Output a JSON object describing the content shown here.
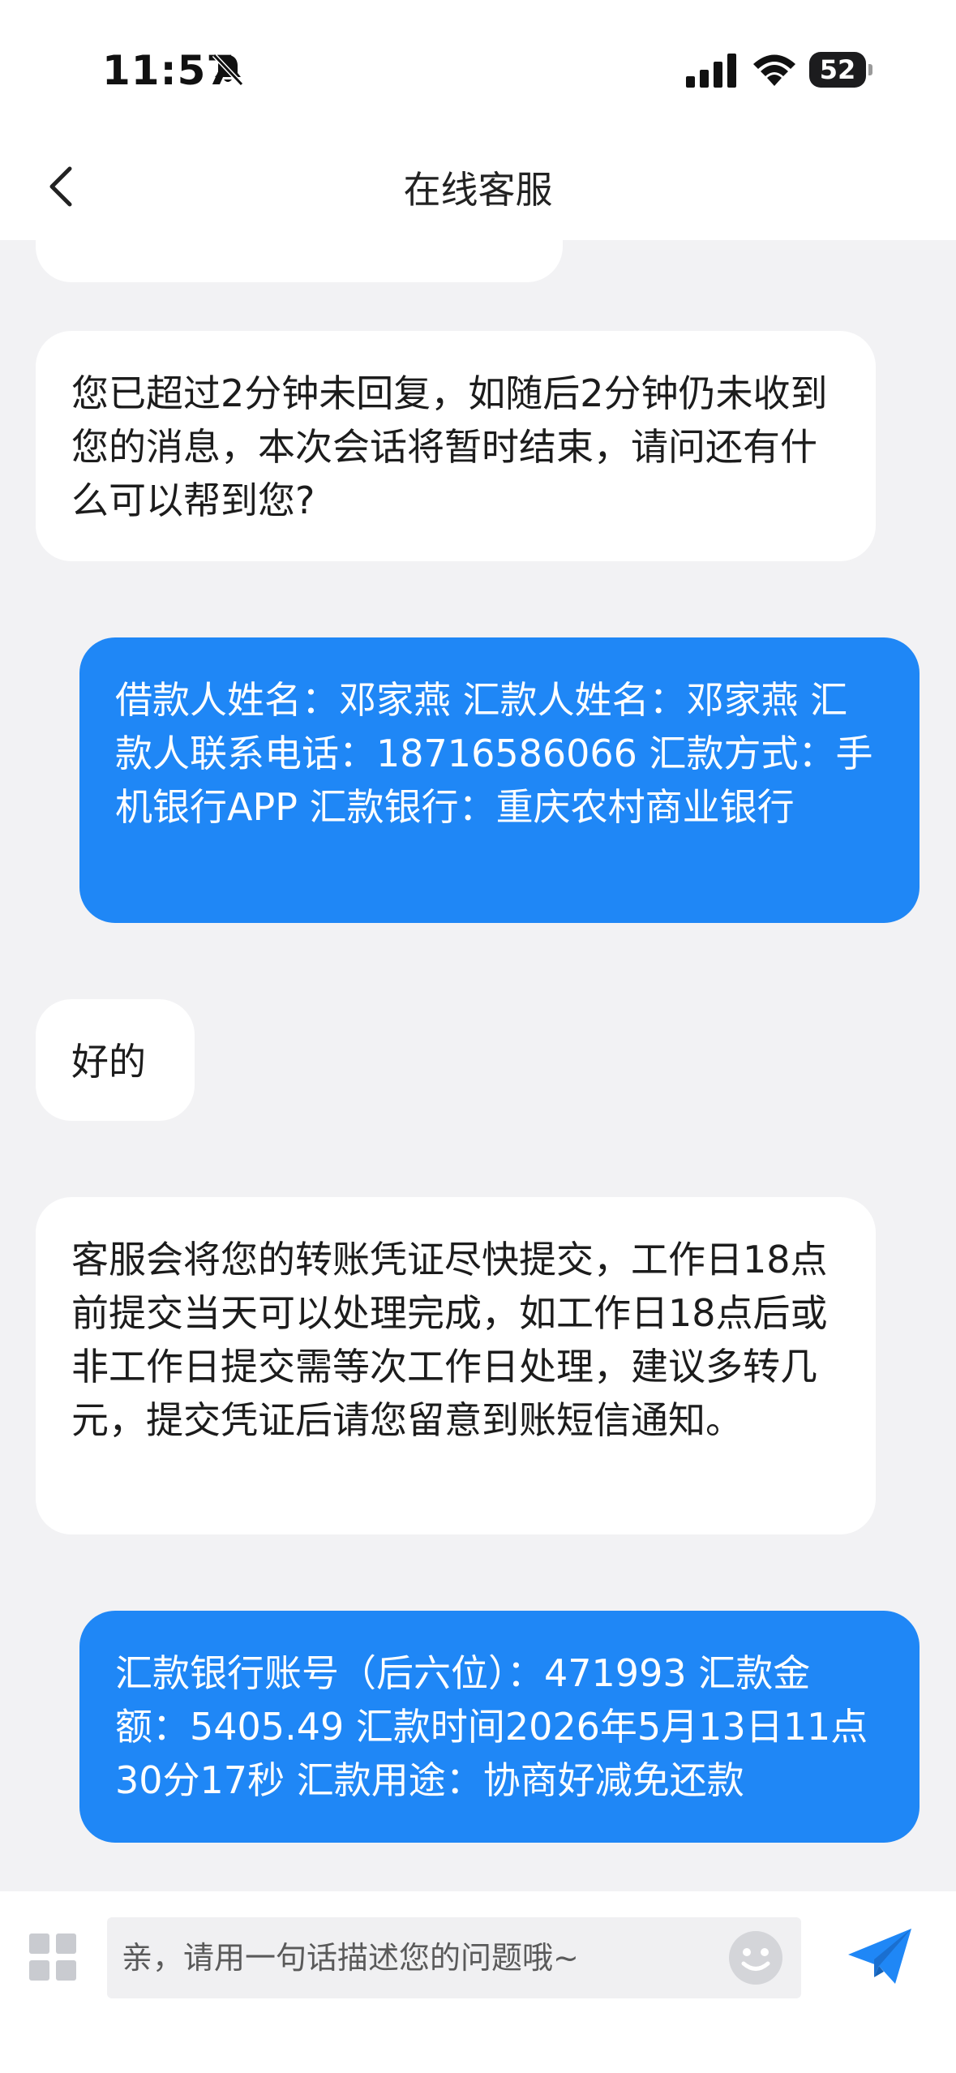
{
  "status_bar": {
    "time": "11:57",
    "battery": "52"
  },
  "header": {
    "title": "在线客服"
  },
  "messages": [
    {
      "side": "left",
      "text": "您已超过2分钟未回复，如随后2分钟仍未收到您的消息，本次会话将暂时结束，请问还有什么可以帮到您?"
    },
    {
      "side": "right",
      "text": "借款人姓名：邓家燕 汇款人姓名：邓家燕 汇款人联系电话：18716586066 汇款方式：手机银行APP 汇款银行：重庆农村商业银行"
    },
    {
      "side": "left",
      "text": "好的"
    },
    {
      "side": "left",
      "text": "客服会将您的转账凭证尽快提交，工作日18点前提交当天可以处理完成，如工作日18点后或非工作日提交需等次工作日处理，建议多转几元，提交凭证后请您留意到账短信通知。"
    },
    {
      "side": "right",
      "text": "汇款银行账号（后六位）：471993 汇款金额：5405.49 汇款时间2026年5月13日11点30分17秒 汇款用途：协商好减免还款"
    }
  ],
  "composer": {
    "placeholder": "亲，请用一句话描述您的问题哦~"
  },
  "colors": {
    "accent": "#1f87f6",
    "background": "#f2f2f4"
  },
  "icons": {
    "bell": "bell-slash-icon",
    "signal": "cellular-signal-icon",
    "wifi": "wifi-icon",
    "back": "chevron-left-icon",
    "menu": "grid-menu-icon",
    "emoji": "emoji-icon",
    "send": "paper-plane-icon"
  }
}
